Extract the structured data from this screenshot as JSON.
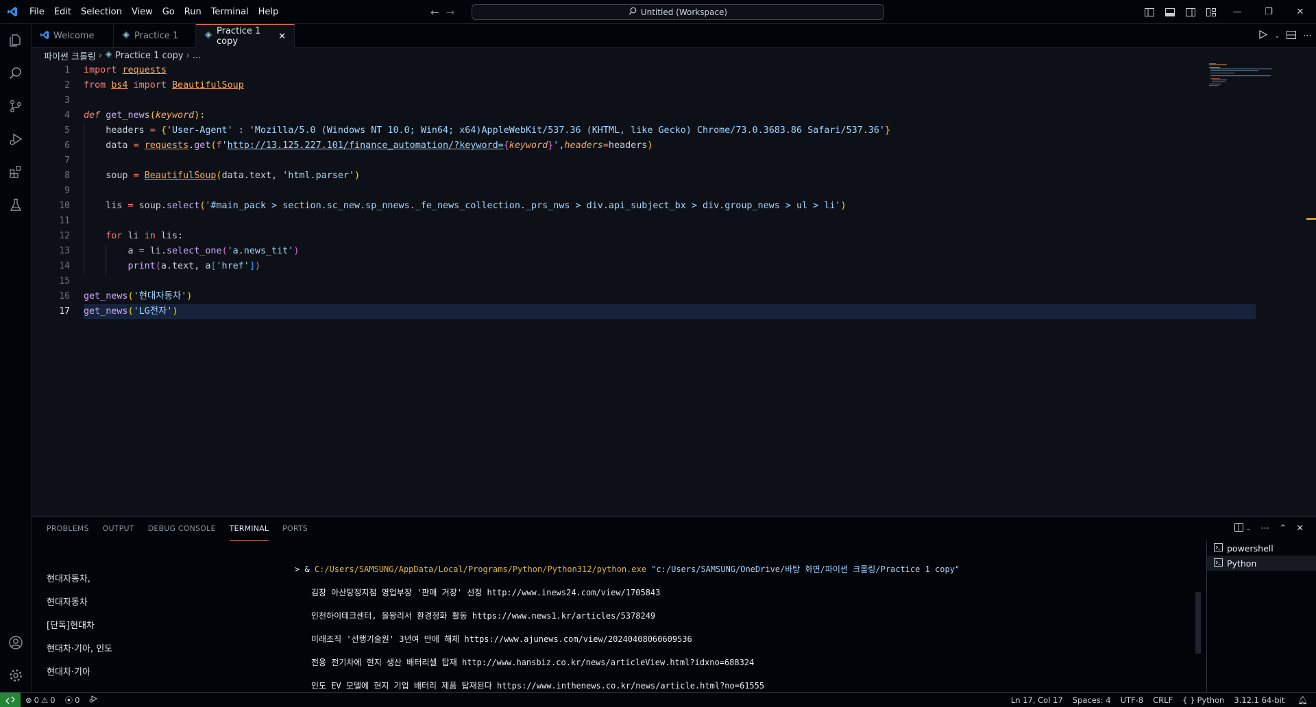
{
  "titlebar": {
    "menu": [
      "File",
      "Edit",
      "Selection",
      "View",
      "Go",
      "Run",
      "Terminal",
      "Help"
    ],
    "command_center": "Untitled (Workspace)"
  },
  "tabs": [
    {
      "label": "Welcome",
      "icon": "vscode-icon",
      "active": false
    },
    {
      "label": "Practice 1",
      "icon": "python-icon",
      "active": false
    },
    {
      "label": "Practice 1 copy",
      "icon": "python-icon",
      "active": true
    }
  ],
  "breadcrumb": {
    "folder": "파이썬 크롤링",
    "file": "Practice 1 copy",
    "more": "..."
  },
  "editor": {
    "current_line": 17,
    "line_numbers": [
      "1",
      "2",
      "3",
      "4",
      "5",
      "6",
      "7",
      "8",
      "9",
      "10",
      "11",
      "12",
      "13",
      "14",
      "15",
      "16",
      "17"
    ],
    "lines": [
      [
        {
          "t": "import ",
          "c": "kw"
        },
        {
          "t": "requests",
          "c": "mod"
        }
      ],
      [
        {
          "t": "from ",
          "c": "kw"
        },
        {
          "t": "bs4",
          "c": "mod"
        },
        {
          "t": " import ",
          "c": "kw"
        },
        {
          "t": "BeautifulSoup",
          "c": "mod"
        }
      ],
      [],
      [
        {
          "t": "def ",
          "c": "def"
        },
        {
          "t": "get_news",
          "c": "fn"
        },
        {
          "t": "(",
          "c": "brk1"
        },
        {
          "t": "keyword",
          "c": "param"
        },
        {
          "t": "):",
          "c": "brk1"
        }
      ],
      [
        {
          "t": "    headers ",
          "c": "var"
        },
        {
          "t": "=",
          "c": "op"
        },
        {
          "t": " {",
          "c": "brk1"
        },
        {
          "t": "'User-Agent'",
          "c": "str"
        },
        {
          "t": " : ",
          "c": "var"
        },
        {
          "t": "'Mozilla/5.0 (Windows NT 10.0; Win64; x64)AppleWebKit/537.36 (KHTML, like Gecko) Chrome/73.0.3683.86 Safari/537.36'",
          "c": "str"
        },
        {
          "t": "}",
          "c": "brk1"
        }
      ],
      [
        {
          "t": "    data ",
          "c": "var"
        },
        {
          "t": "=",
          "c": "op"
        },
        {
          "t": " ",
          "c": "var"
        },
        {
          "t": "requests",
          "c": "mod"
        },
        {
          "t": ".",
          "c": "var"
        },
        {
          "t": "get",
          "c": "fn"
        },
        {
          "t": "(",
          "c": "brk1"
        },
        {
          "t": "f",
          "c": "kw"
        },
        {
          "t": "'",
          "c": "str"
        },
        {
          "t": "http://13.125.227.101/finance_automation/?keyword=",
          "c": "str u"
        },
        {
          "t": "{",
          "c": "brk2"
        },
        {
          "t": "keyword",
          "c": "param"
        },
        {
          "t": "}",
          "c": "brk2"
        },
        {
          "t": "'",
          "c": "str"
        },
        {
          "t": ",",
          "c": "var"
        },
        {
          "t": "headers",
          "c": "param"
        },
        {
          "t": "=",
          "c": "op"
        },
        {
          "t": "headers",
          "c": "var"
        },
        {
          "t": ")",
          "c": "brk1"
        }
      ],
      [],
      [
        {
          "t": "    soup ",
          "c": "var"
        },
        {
          "t": "=",
          "c": "op"
        },
        {
          "t": " ",
          "c": "var"
        },
        {
          "t": "BeautifulSoup",
          "c": "mod"
        },
        {
          "t": "(",
          "c": "brk1"
        },
        {
          "t": "data.text, ",
          "c": "var"
        },
        {
          "t": "'html.parser'",
          "c": "str"
        },
        {
          "t": ")",
          "c": "brk1"
        }
      ],
      [],
      [
        {
          "t": "    lis ",
          "c": "var"
        },
        {
          "t": "=",
          "c": "op"
        },
        {
          "t": " soup.",
          "c": "var"
        },
        {
          "t": "select",
          "c": "fn"
        },
        {
          "t": "(",
          "c": "brk1"
        },
        {
          "t": "'#main_pack > section.sc_new.sp_nnews._fe_news_collection._prs_nws > div.api_subject_bx > div.group_news > ul > li'",
          "c": "str"
        },
        {
          "t": ")",
          "c": "brk1"
        }
      ],
      [],
      [
        {
          "t": "    ",
          "c": "var"
        },
        {
          "t": "for",
          "c": "kw"
        },
        {
          "t": " li ",
          "c": "var"
        },
        {
          "t": "in",
          "c": "kw"
        },
        {
          "t": " lis:",
          "c": "var"
        }
      ],
      [
        {
          "t": "        a ",
          "c": "var"
        },
        {
          "t": "=",
          "c": "op"
        },
        {
          "t": " li.",
          "c": "var"
        },
        {
          "t": "select_one",
          "c": "fn"
        },
        {
          "t": "(",
          "c": "brk2"
        },
        {
          "t": "'a.news_tit'",
          "c": "str"
        },
        {
          "t": ")",
          "c": "brk2"
        }
      ],
      [
        {
          "t": "        ",
          "c": "var"
        },
        {
          "t": "print",
          "c": "fn"
        },
        {
          "t": "(",
          "c": "brk2"
        },
        {
          "t": "a.text, a",
          "c": "var"
        },
        {
          "t": "[",
          "c": "brk3"
        },
        {
          "t": "'href'",
          "c": "str"
        },
        {
          "t": "]",
          "c": "brk3"
        },
        {
          "t": ")",
          "c": "brk2"
        }
      ],
      [],
      [
        {
          "t": "get_news",
          "c": "fn"
        },
        {
          "t": "(",
          "c": "brk1"
        },
        {
          "t": "'현대자동차'",
          "c": "str"
        },
        {
          "t": ")",
          "c": "brk1"
        }
      ],
      [
        {
          "t": "get_news",
          "c": "fn"
        },
        {
          "t": "(",
          "c": "brk1"
        },
        {
          "t": "'LG전자'",
          "c": "str"
        },
        {
          "t": ")",
          "c": "brk1"
        }
      ]
    ]
  },
  "panel": {
    "tabs": [
      "PROBLEMS",
      "OUTPUT",
      "DEBUG CONSOLE",
      "TERMINAL",
      "PORTS"
    ],
    "active_tab": "TERMINAL",
    "terminal_left": [
      "현대자동차,",
      "현대자동차",
      "[단독]현대차",
      "현대차·기아, 인도",
      "현대차·기아"
    ],
    "command": {
      "prompt": "> & ",
      "exe": "C:/Users/SAMSUNG/AppData/Local/Programs/Python/Python312/python.exe",
      "arg": " \"c:/Users/SAMSUNG/OneDrive/바탕 화면/파이썬 크롤링/Practice 1 copy\""
    },
    "output_lines": [
      "김창 아산탕정지점 영업부장 '판매 거장' 선정 http://www.inews24.com/view/1705843",
      "인천하이테크센터, 을왕리서 환경정화 활동 https://www.news1.kr/articles/5378249",
      "미래조직 '선행기술원' 3년여 만에 해체 https://www.ajunews.com/view/20240408060609536",
      "전용 전기차에 현지 생산 배터리셀 탑재 http://www.hansbiz.co.kr/news/articleView.html?idxno=688324",
      "인도 EV 모델에 현지 기업 배터리 제품 탑재된다 https://www.inthenews.co.kr/news/article.html?no=61555"
    ],
    "terminals": [
      {
        "label": "powershell",
        "active": false
      },
      {
        "label": "Python",
        "active": true
      }
    ]
  },
  "statusbar": {
    "errors": "0",
    "warnings": "0",
    "ports": "0",
    "position": "Ln 17, Col 17",
    "spaces": "Spaces: 4",
    "encoding": "UTF-8",
    "eol": "CRLF",
    "language": "Python",
    "interpreter": "3.12.1 64-bit"
  },
  "colors": {
    "accent": "#f78166",
    "background": "#0d1117",
    "remote": "#238636"
  }
}
